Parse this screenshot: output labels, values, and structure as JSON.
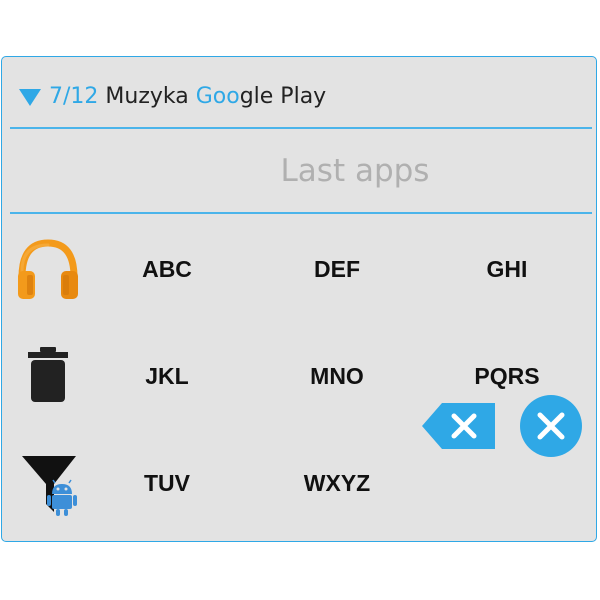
{
  "header": {
    "count": "7/12",
    "app_name_part1": "Muzyka ",
    "app_name_accent": "Goo",
    "app_name_part2": "gle Play"
  },
  "search": {
    "placeholder": "Last apps",
    "value": ""
  },
  "side_icons": [
    {
      "name": "headphones-icon",
      "meaning": "Muzyka Google Play app icon"
    },
    {
      "name": "trash-icon"
    },
    {
      "name": "android-filter-icon"
    }
  ],
  "keypad": {
    "row1": [
      "ABC",
      "DEF",
      "GHI"
    ],
    "row2": [
      "JKL",
      "MNO",
      "PQRS"
    ],
    "row3": [
      "TUV",
      "WXYZ"
    ]
  },
  "actions": {
    "backspace_icon": "backspace-icon",
    "close_icon": "close-icon"
  },
  "colors": {
    "accent": "#2fa8e6",
    "panel_bg": "#e3e3e3",
    "headphones_orange": "#f39a1b",
    "icon_dark": "#222222",
    "android_blue": "#3d8fd8"
  }
}
